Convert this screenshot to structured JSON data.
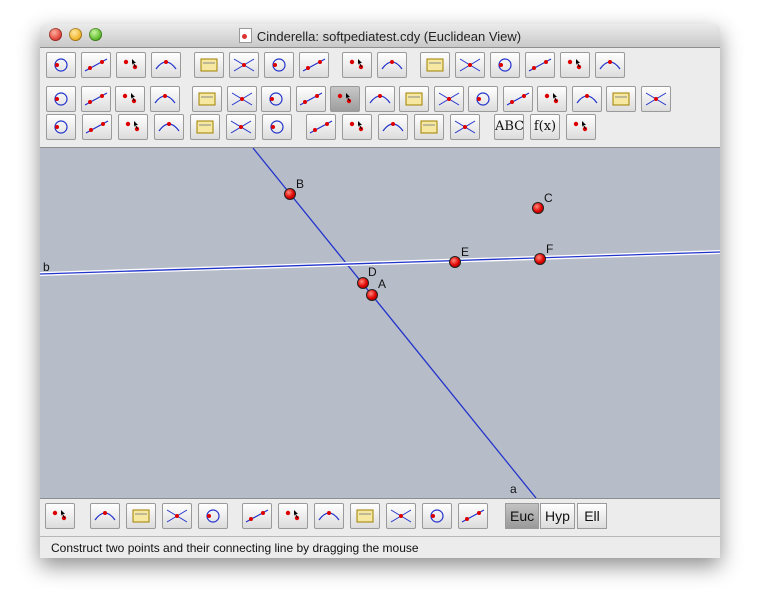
{
  "window": {
    "title": "Cinderella: softpediatest.cdy (Euclidean View)"
  },
  "toolbar_top": [
    {
      "name": "new-file-icon"
    },
    {
      "name": "open-file-icon"
    },
    {
      "name": "save-icon"
    },
    {
      "name": "save-as-icon"
    },
    {
      "name": "web-export-icon"
    },
    {
      "name": "rss-icon"
    },
    {
      "name": "help-icon"
    },
    {
      "name": "info-icon"
    },
    {
      "name": "undo-icon"
    },
    {
      "name": "redo-icon"
    },
    {
      "name": "select-lines-icon"
    },
    {
      "name": "select-points-icon"
    },
    {
      "name": "select-segments-icon"
    },
    {
      "name": "select-circles-icon"
    },
    {
      "name": "select-conics-icon"
    },
    {
      "name": "eraser-icon"
    }
  ],
  "toolbar_middle": [
    {
      "name": "move-tool-icon"
    },
    {
      "name": "properties-icon"
    },
    {
      "name": "conic-icon"
    },
    {
      "name": "appearance-icon"
    },
    {
      "name": "add-point-icon"
    },
    {
      "name": "intersection-icon"
    },
    {
      "name": "midpoint-icon"
    },
    {
      "name": "circle-icon"
    },
    {
      "name": "line-tool-icon",
      "pressed": true
    },
    {
      "name": "segment-icon"
    },
    {
      "name": "parallel-icon"
    },
    {
      "name": "orthogonal-icon"
    },
    {
      "name": "line-through-point-icon"
    },
    {
      "name": "angle-bisector-icon"
    },
    {
      "name": "compass-icon"
    },
    {
      "name": "circle-by-radius-icon"
    },
    {
      "name": "circle-center-icon"
    },
    {
      "name": "circle-three-points-icon"
    }
  ],
  "toolbar_bottom": [
    {
      "name": "compass-construct-icon"
    },
    {
      "name": "circle-3-points-icon"
    },
    {
      "name": "polygon-path-icon"
    },
    {
      "name": "conic-5-points-icon"
    },
    {
      "name": "ellipse-icon"
    },
    {
      "name": "locus-icon"
    },
    {
      "name": "parabola-icon"
    },
    {
      "name": "animation-icon"
    },
    {
      "name": "transform-icon"
    },
    {
      "name": "mirror-icon"
    },
    {
      "name": "measure-icon"
    },
    {
      "name": "polygon-icon"
    },
    {
      "name": "text-tool",
      "label": "ABC"
    },
    {
      "name": "function-tool",
      "label": "f(x)"
    },
    {
      "name": "angle-measure-icon"
    }
  ],
  "points": [
    {
      "label": "B",
      "color": "#e00000"
    },
    {
      "label": "C",
      "color": "#e00000"
    },
    {
      "label": "E",
      "color": "#e00000"
    },
    {
      "label": "F",
      "color": "#e00000"
    },
    {
      "label": "D",
      "color": "#e00000"
    },
    {
      "label": "A",
      "color": "#e00000"
    }
  ],
  "lines": [
    {
      "label": "a",
      "color": "#2233cc"
    },
    {
      "label": "b",
      "color": "#2233cc"
    }
  ],
  "bottom_toolbar": {
    "left_icons": [
      {
        "name": "pdf-export-icon"
      },
      {
        "name": "translate-view-icon"
      },
      {
        "name": "zoom-in-icon"
      },
      {
        "name": "zoom-out-icon"
      },
      {
        "name": "lasso-icon"
      },
      {
        "name": "grid-finer-icon"
      },
      {
        "name": "grid-coarser-icon"
      },
      {
        "name": "axes-icon"
      },
      {
        "name": "square-grid-icon"
      },
      {
        "name": "triangular-grid-icon"
      },
      {
        "name": "snap-icon"
      },
      {
        "name": "camera-icon"
      }
    ],
    "geometry_buttons": [
      {
        "label": "Euc",
        "active": true
      },
      {
        "label": "Hyp",
        "active": false
      },
      {
        "label": "Ell",
        "active": false
      }
    ]
  },
  "status": "Construct two points and their connecting line by dragging the mouse",
  "colors": {
    "canvas": "#b6bcc8",
    "point": "#e00000",
    "line": "#2233cc"
  }
}
